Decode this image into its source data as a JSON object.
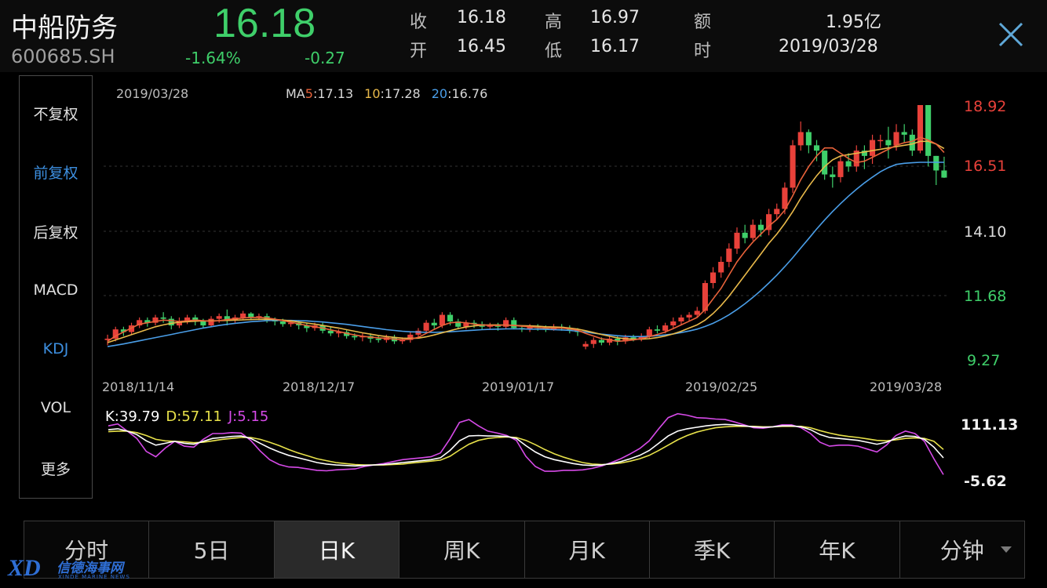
{
  "header": {
    "name": "中船防务",
    "code": "600685.SH",
    "price": "16.18",
    "change_pct": "-1.64%",
    "change": "-0.27",
    "quotes": [
      {
        "label": "收",
        "value": "16.18"
      },
      {
        "label": "开",
        "value": "16.45"
      },
      {
        "label": "高",
        "value": "16.97"
      },
      {
        "label": "低",
        "value": "16.17"
      },
      {
        "label": "额",
        "value": "1.95亿"
      },
      {
        "label": "时",
        "value": "2019/03/28"
      }
    ]
  },
  "left_menu": [
    {
      "label": "不复权",
      "active": false
    },
    {
      "label": "前复权",
      "active": true
    },
    {
      "label": "后复权",
      "active": false
    },
    {
      "label": "MACD",
      "active": false
    },
    {
      "label": "KDJ",
      "active": true
    },
    {
      "label": "VOL",
      "active": false
    },
    {
      "label": "更多",
      "active": false
    }
  ],
  "main_chart": {
    "date": "2019/03/28",
    "ma_label": "MA",
    "ma5_period": "5",
    "ma5_value": ":17.13",
    "ma10_period": "10",
    "ma10_value": ":17.28",
    "ma20_period": "20",
    "ma20_value": ":16.76",
    "y_labels": [
      "18.92",
      "16.51",
      "14.10",
      "11.68",
      "9.27"
    ],
    "x_labels": [
      "2018/11/14",
      "2018/12/17",
      "2019/01/17",
      "2019/02/25",
      "2019/03/28"
    ]
  },
  "kdj": {
    "k_label": "K:39.79",
    "d_label": "D:57.11",
    "j_label": "J:5.15",
    "y_labels": [
      "111.13",
      "-5.62"
    ]
  },
  "tabs": [
    {
      "label": "分时",
      "active": false
    },
    {
      "label": "5日",
      "active": false
    },
    {
      "label": "日K",
      "active": true
    },
    {
      "label": "周K",
      "active": false
    },
    {
      "label": "月K",
      "active": false
    },
    {
      "label": "季K",
      "active": false
    },
    {
      "label": "年K",
      "active": false
    },
    {
      "label": "分钟",
      "active": false,
      "dropdown": true
    }
  ],
  "watermark": {
    "mark": "XD",
    "cn": "信德海事网",
    "en": "XINDE MARINE NEWS"
  },
  "colors": {
    "up": "#e8413a",
    "down": "#3fcf6a",
    "ma5": "#e8623a",
    "ma10": "#e8b94a",
    "ma20": "#4a9ee8",
    "k": "#ffffff",
    "d": "#e8e24a",
    "j": "#d64ae8",
    "active": "#3d8fe0"
  },
  "chart_data": {
    "type": "candlestick",
    "title": "",
    "ylim": [
      9.27,
      18.92
    ],
    "candles": [
      [
        10.05,
        10.1,
        9.85,
        10.25
      ],
      [
        10.1,
        10.45,
        10.0,
        10.55
      ],
      [
        10.45,
        10.35,
        10.2,
        10.55
      ],
      [
        10.35,
        10.6,
        10.25,
        10.7
      ],
      [
        10.6,
        10.8,
        10.5,
        10.9
      ],
      [
        10.8,
        10.7,
        10.55,
        10.9
      ],
      [
        10.7,
        10.9,
        10.6,
        11.0
      ],
      [
        10.9,
        10.85,
        10.7,
        11.1
      ],
      [
        10.85,
        10.6,
        10.45,
        10.95
      ],
      [
        10.6,
        10.75,
        10.5,
        10.9
      ],
      [
        10.75,
        10.9,
        10.65,
        11.0
      ],
      [
        10.9,
        10.75,
        10.6,
        11.0
      ],
      [
        10.75,
        10.6,
        10.5,
        10.85
      ],
      [
        10.6,
        10.85,
        10.55,
        10.95
      ],
      [
        10.85,
        10.95,
        10.7,
        11.05
      ],
      [
        10.95,
        10.8,
        10.6,
        11.2
      ],
      [
        10.8,
        10.9,
        10.7,
        11.0
      ],
      [
        10.9,
        11.05,
        10.8,
        11.15
      ],
      [
        11.05,
        10.9,
        10.8,
        11.1
      ],
      [
        10.9,
        10.95,
        10.8,
        11.05
      ],
      [
        10.95,
        10.8,
        10.7,
        11.05
      ],
      [
        10.8,
        10.75,
        10.6,
        10.9
      ],
      [
        10.75,
        10.65,
        10.55,
        10.85
      ],
      [
        10.65,
        10.7,
        10.55,
        10.8
      ],
      [
        10.7,
        10.6,
        10.45,
        10.8
      ],
      [
        10.6,
        10.5,
        10.35,
        10.7
      ],
      [
        10.5,
        10.6,
        10.4,
        10.7
      ],
      [
        10.6,
        10.4,
        10.3,
        10.7
      ],
      [
        10.4,
        10.3,
        10.2,
        10.55
      ],
      [
        10.3,
        10.35,
        10.15,
        10.45
      ],
      [
        10.35,
        10.2,
        10.1,
        10.45
      ],
      [
        10.2,
        10.15,
        10.05,
        10.3
      ],
      [
        10.15,
        10.2,
        10.0,
        10.3
      ],
      [
        10.2,
        10.1,
        9.95,
        10.3
      ],
      [
        10.1,
        10.05,
        9.95,
        10.2
      ],
      [
        10.05,
        10.15,
        9.95,
        10.25
      ],
      [
        10.15,
        10.0,
        9.9,
        10.25
      ],
      [
        10.0,
        10.05,
        9.9,
        10.15
      ],
      [
        10.05,
        10.25,
        9.95,
        10.35
      ],
      [
        10.25,
        10.4,
        10.15,
        10.5
      ],
      [
        10.4,
        10.7,
        10.3,
        10.8
      ],
      [
        10.7,
        10.6,
        10.45,
        10.85
      ],
      [
        10.6,
        11.0,
        10.5,
        11.1
      ],
      [
        11.0,
        10.75,
        10.6,
        11.1
      ],
      [
        10.75,
        10.55,
        10.45,
        10.85
      ],
      [
        10.55,
        10.7,
        10.45,
        10.8
      ],
      [
        10.7,
        10.65,
        10.5,
        10.8
      ],
      [
        10.65,
        10.55,
        10.45,
        10.75
      ],
      [
        10.55,
        10.6,
        10.45,
        10.7
      ],
      [
        10.6,
        10.55,
        10.4,
        10.7
      ],
      [
        10.55,
        10.8,
        10.45,
        10.9
      ],
      [
        10.8,
        10.5,
        10.45,
        10.9
      ],
      [
        10.5,
        10.45,
        10.35,
        10.6
      ],
      [
        10.45,
        10.55,
        10.35,
        10.65
      ],
      [
        10.55,
        10.5,
        10.4,
        10.65
      ],
      [
        10.5,
        10.45,
        10.35,
        10.6
      ],
      [
        10.45,
        10.55,
        10.4,
        10.65
      ],
      [
        10.55,
        10.5,
        10.4,
        10.65
      ],
      [
        10.5,
        10.4,
        10.3,
        10.6
      ],
      [
        10.4,
        10.35,
        10.2,
        10.5
      ],
      [
        9.8,
        9.9,
        9.7,
        10.0
      ],
      [
        9.9,
        10.05,
        9.75,
        10.15
      ],
      [
        10.05,
        9.95,
        9.85,
        10.15
      ],
      [
        9.95,
        10.1,
        9.85,
        10.2
      ],
      [
        10.1,
        10.0,
        9.85,
        10.2
      ],
      [
        10.0,
        10.15,
        9.9,
        10.25
      ],
      [
        10.15,
        10.1,
        10.0,
        10.25
      ],
      [
        10.1,
        10.2,
        10.0,
        10.3
      ],
      [
        10.2,
        10.45,
        10.1,
        10.55
      ],
      [
        10.45,
        10.4,
        10.3,
        10.6
      ],
      [
        10.4,
        10.6,
        10.3,
        10.7
      ],
      [
        10.6,
        10.75,
        10.5,
        10.9
      ],
      [
        10.75,
        10.9,
        10.6,
        11.0
      ],
      [
        10.9,
        11.0,
        10.75,
        11.1
      ],
      [
        11.0,
        11.15,
        10.9,
        11.3
      ],
      [
        11.15,
        12.2,
        11.05,
        12.3
      ],
      [
        12.2,
        12.6,
        12.0,
        12.8
      ],
      [
        12.6,
        13.0,
        12.4,
        13.2
      ],
      [
        13.0,
        13.5,
        12.8,
        13.7
      ],
      [
        13.5,
        14.1,
        13.3,
        14.3
      ],
      [
        14.1,
        13.9,
        13.7,
        14.4
      ],
      [
        13.9,
        14.4,
        13.8,
        14.6
      ],
      [
        14.4,
        14.2,
        13.95,
        14.6
      ],
      [
        14.2,
        14.8,
        14.0,
        15.0
      ],
      [
        14.8,
        15.0,
        14.6,
        15.2
      ],
      [
        15.0,
        15.8,
        14.8,
        16.0
      ],
      [
        15.8,
        17.4,
        15.6,
        17.6
      ],
      [
        17.4,
        17.9,
        17.2,
        18.3
      ],
      [
        17.9,
        17.4,
        17.1,
        18.0
      ],
      [
        17.4,
        17.2,
        16.8,
        17.6
      ],
      [
        17.2,
        16.3,
        16.1,
        17.2
      ],
      [
        16.3,
        16.2,
        15.8,
        16.6
      ],
      [
        16.2,
        16.8,
        16.0,
        17.0
      ],
      [
        16.8,
        16.6,
        16.4,
        17.1
      ],
      [
        16.6,
        17.2,
        16.4,
        17.4
      ],
      [
        17.2,
        17.0,
        16.5,
        17.4
      ],
      [
        17.0,
        17.6,
        16.7,
        17.8
      ],
      [
        17.6,
        17.6,
        17.3,
        17.8
      ],
      [
        17.6,
        17.4,
        16.9,
        18.1
      ],
      [
        17.4,
        17.9,
        17.2,
        18.2
      ],
      [
        17.9,
        17.8,
        17.5,
        18.2
      ],
      [
        17.8,
        17.2,
        17.0,
        18.0
      ],
      [
        17.2,
        18.92,
        17.1,
        18.92
      ],
      [
        18.92,
        17.0,
        16.6,
        18.92
      ],
      [
        17.0,
        16.45,
        15.9,
        17.0
      ],
      [
        16.45,
        16.18,
        16.17,
        16.97
      ]
    ],
    "ma5": [
      10.0,
      10.2,
      10.35,
      10.5,
      10.65,
      10.7,
      10.75,
      10.8,
      10.78,
      10.75,
      10.78,
      10.8,
      10.78,
      10.75,
      10.78,
      10.82,
      10.85,
      10.88,
      10.9,
      10.9,
      10.88,
      10.84,
      10.78,
      10.72,
      10.66,
      10.6,
      10.55,
      10.5,
      10.43,
      10.37,
      10.3,
      10.24,
      10.19,
      10.16,
      10.13,
      10.11,
      10.08,
      10.06,
      10.08,
      10.15,
      10.3,
      10.45,
      10.6,
      10.7,
      10.72,
      10.7,
      10.65,
      10.62,
      10.6,
      10.6,
      10.62,
      10.6,
      10.57,
      10.55,
      10.52,
      10.5,
      10.5,
      10.5,
      10.47,
      10.42,
      10.3,
      10.2,
      10.1,
      10.05,
      10.0,
      10.02,
      10.05,
      10.1,
      10.18,
      10.26,
      10.35,
      10.48,
      10.62,
      10.76,
      10.9,
      11.2,
      11.6,
      12.0,
      12.5,
      13.0,
      13.4,
      13.75,
      14.05,
      14.35,
      14.6,
      14.95,
      15.5,
      16.1,
      16.6,
      17.0,
      17.3,
      17.3,
      17.1,
      16.9,
      16.75,
      16.8,
      16.95,
      17.1,
      17.25,
      17.4,
      17.5,
      17.55,
      17.7,
      17.6,
      17.45,
      17.13
    ],
    "ma10": [
      9.95,
      10.05,
      10.15,
      10.25,
      10.35,
      10.45,
      10.55,
      10.62,
      10.68,
      10.72,
      10.74,
      10.76,
      10.77,
      10.77,
      10.78,
      10.79,
      10.8,
      10.81,
      10.82,
      10.83,
      10.83,
      10.82,
      10.8,
      10.77,
      10.73,
      10.69,
      10.65,
      10.6,
      10.55,
      10.5,
      10.44,
      10.38,
      10.32,
      10.27,
      10.22,
      10.18,
      10.15,
      10.12,
      10.11,
      10.12,
      10.17,
      10.24,
      10.32,
      10.4,
      10.48,
      10.54,
      10.58,
      10.61,
      10.62,
      10.62,
      10.61,
      10.6,
      10.59,
      10.58,
      10.57,
      10.55,
      10.54,
      10.53,
      10.5,
      10.46,
      10.4,
      10.33,
      10.26,
      10.19,
      10.13,
      10.1,
      10.08,
      10.08,
      10.1,
      10.14,
      10.2,
      10.28,
      10.38,
      10.5,
      10.62,
      10.8,
      11.05,
      11.35,
      11.7,
      12.1,
      12.5,
      12.9,
      13.3,
      13.7,
      14.05,
      14.45,
      14.9,
      15.4,
      15.85,
      16.25,
      16.6,
      16.85,
      17.0,
      17.05,
      17.1,
      17.15,
      17.2,
      17.25,
      17.3,
      17.35,
      17.4,
      17.45,
      17.55,
      17.55,
      17.45,
      17.28
    ],
    "ma20": [
      9.8,
      9.85,
      9.9,
      9.96,
      10.02,
      10.08,
      10.14,
      10.2,
      10.26,
      10.32,
      10.38,
      10.44,
      10.5,
      10.55,
      10.6,
      10.64,
      10.68,
      10.71,
      10.74,
      10.76,
      10.78,
      10.79,
      10.79,
      10.79,
      10.78,
      10.77,
      10.75,
      10.73,
      10.7,
      10.67,
      10.64,
      10.6,
      10.56,
      10.52,
      10.48,
      10.44,
      10.41,
      10.38,
      10.36,
      10.35,
      10.34,
      10.34,
      10.35,
      10.36,
      10.38,
      10.4,
      10.42,
      10.44,
      10.45,
      10.46,
      10.47,
      10.47,
      10.47,
      10.46,
      10.46,
      10.45,
      10.44,
      10.43,
      10.41,
      10.38,
      10.35,
      10.31,
      10.27,
      10.24,
      10.21,
      10.19,
      10.18,
      10.18,
      10.19,
      10.21,
      10.24,
      10.28,
      10.33,
      10.39,
      10.46,
      10.56,
      10.68,
      10.83,
      11.0,
      11.2,
      11.42,
      11.66,
      11.92,
      12.2,
      12.5,
      12.82,
      13.16,
      13.52,
      13.88,
      14.24,
      14.58,
      14.9,
      15.2,
      15.48,
      15.74,
      15.98,
      16.2,
      16.4,
      16.56,
      16.68,
      16.72,
      16.74,
      16.76,
      16.76,
      16.76,
      16.76
    ],
    "kdj_ylim": [
      -5.62,
      111.13
    ],
    "k": [
      98,
      100,
      95,
      88,
      75,
      66,
      70,
      74,
      70,
      68,
      74,
      80,
      82,
      84,
      85,
      80,
      70,
      60,
      52,
      45,
      40,
      35,
      30,
      27,
      25,
      24,
      23,
      24,
      25,
      26,
      28,
      30,
      32,
      34,
      36,
      40,
      55,
      75,
      85,
      86,
      85,
      85,
      84,
      80,
      65,
      52,
      42,
      36,
      32,
      28,
      25,
      24,
      25,
      28,
      32,
      38,
      45,
      55,
      70,
      85,
      95,
      100,
      103,
      106,
      108,
      109,
      108,
      106,
      104,
      103,
      104,
      106,
      106,
      104,
      98,
      88,
      82,
      80,
      78,
      76,
      72,
      68,
      72,
      80,
      85,
      84,
      78,
      62,
      39.79
    ],
    "d": [
      94,
      95,
      95,
      92,
      86,
      78,
      75,
      74,
      73,
      71,
      72,
      75,
      78,
      80,
      82,
      82,
      78,
      72,
      65,
      57,
      50,
      44,
      38,
      34,
      30,
      28,
      26,
      25,
      25,
      25,
      26,
      27,
      29,
      31,
      33,
      35,
      43,
      56,
      68,
      76,
      80,
      82,
      83,
      82,
      76,
      67,
      57,
      48,
      41,
      35,
      30,
      27,
      26,
      27,
      29,
      33,
      38,
      45,
      55,
      66,
      77,
      86,
      93,
      98,
      102,
      104,
      105,
      105,
      105,
      104,
      104,
      105,
      105,
      105,
      102,
      96,
      91,
      87,
      84,
      82,
      79,
      76,
      75,
      77,
      80,
      81,
      80,
      74,
      57.11
    ],
    "j": [
      106,
      110,
      95,
      80,
      53,
      42,
      60,
      74,
      64,
      62,
      78,
      90,
      90,
      92,
      91,
      76,
      54,
      36,
      26,
      21,
      20,
      17,
      14,
      13,
      15,
      16,
      17,
      22,
      25,
      28,
      32,
      36,
      38,
      40,
      42,
      50,
      79,
      113,
      119,
      106,
      95,
      91,
      86,
      76,
      43,
      22,
      12,
      12,
      14,
      14,
      15,
      18,
      23,
      30,
      38,
      48,
      59,
      75,
      100,
      123,
      131,
      128,
      123,
      122,
      120,
      119,
      114,
      108,
      102,
      101,
      104,
      108,
      108,
      102,
      90,
      72,
      64,
      66,
      66,
      64,
      58,
      52,
      66,
      86,
      95,
      90,
      74,
      38,
      5.15
    ]
  }
}
